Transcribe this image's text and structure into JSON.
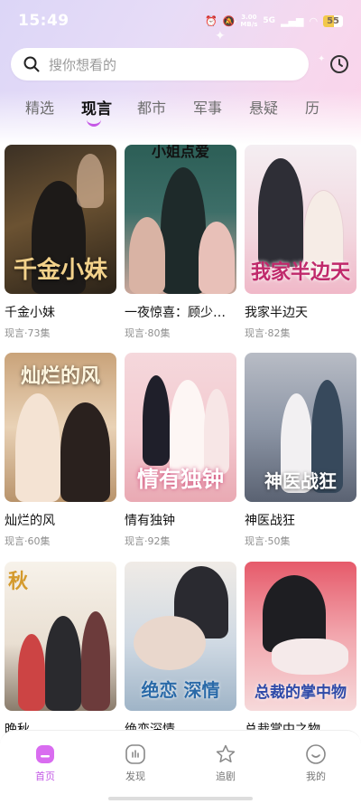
{
  "status_bar": {
    "time": "15:49",
    "net_speed_top": "3.00",
    "net_speed_bottom": "MB/s",
    "signal": "5G",
    "battery": "55"
  },
  "search": {
    "placeholder": "搜你想看的"
  },
  "tabs": [
    {
      "label": "精选"
    },
    {
      "label": "现言"
    },
    {
      "label": "都市"
    },
    {
      "label": "军事"
    },
    {
      "label": "悬疑"
    },
    {
      "label": "历"
    }
  ],
  "active_tab": "现言",
  "dramas": [
    {
      "title": "千金小妹",
      "meta": "现言·73集",
      "poster_text": "千金小妹"
    },
    {
      "title": "一夜惊喜：顾少…",
      "meta": "现言·80集",
      "poster_text": "小姐点爱"
    },
    {
      "title": "我家半边天",
      "meta": "现言·82集",
      "poster_text": "我家半边天"
    },
    {
      "title": "灿烂的风",
      "meta": "现言·60集",
      "poster_text": "灿烂的风"
    },
    {
      "title": "情有独钟",
      "meta": "现言·92集",
      "poster_text": "情有独钟"
    },
    {
      "title": "神医战狂",
      "meta": "现言·50集",
      "poster_text": "神医战狂"
    },
    {
      "title": "晚秋",
      "meta": "",
      "poster_text": "秋"
    },
    {
      "title": "绝恋深情",
      "meta": "",
      "poster_text": "绝恋 深情"
    },
    {
      "title": "总裁掌中之物",
      "meta": "",
      "poster_text": "总裁的掌中物"
    }
  ],
  "bottom_nav": [
    {
      "label": "首页",
      "icon": "home-icon",
      "active": true
    },
    {
      "label": "发现",
      "icon": "discover-icon",
      "active": false
    },
    {
      "label": "追剧",
      "icon": "star-icon",
      "active": false
    },
    {
      "label": "我的",
      "icon": "profile-icon",
      "active": false
    }
  ],
  "colors": {
    "accent": "#c35ae6",
    "text_primary": "#111111",
    "text_meta": "#8f8f8f"
  }
}
